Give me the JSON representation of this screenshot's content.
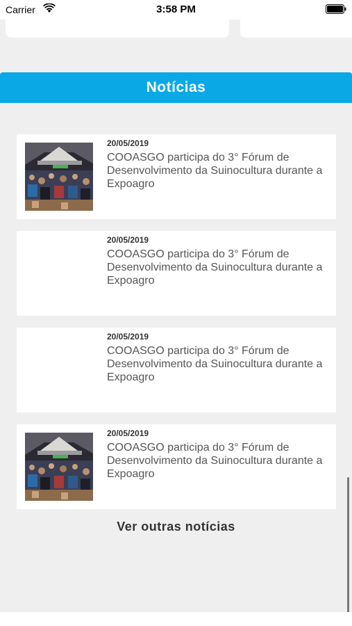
{
  "status_bar": {
    "carrier": "Carrier",
    "time": "3:58 PM"
  },
  "section": {
    "title": "Notícias",
    "accent": "#0aa9e6"
  },
  "news": [
    {
      "date": "20/05/2019",
      "title": "COOASGO participa do 3° Fórum de Desenvolvimento da Suinocultura durante a Expoagro",
      "has_image": true
    },
    {
      "date": "20/05/2019",
      "title": "COOASGO participa do 3° Fórum de Desenvolvimento da Suinocultura durante a Expoagro",
      "has_image": false
    },
    {
      "date": "20/05/2019",
      "title": "COOASGO participa do 3° Fórum de Desenvolvimento da Suinocultura durante a Expoagro",
      "has_image": false
    },
    {
      "date": "20/05/2019",
      "title": "COOASGO participa do 3° Fórum de Desenvolvimento da Suinocultura durante a Expoagro",
      "has_image": true
    }
  ],
  "more_link": "Ver outras notícias"
}
